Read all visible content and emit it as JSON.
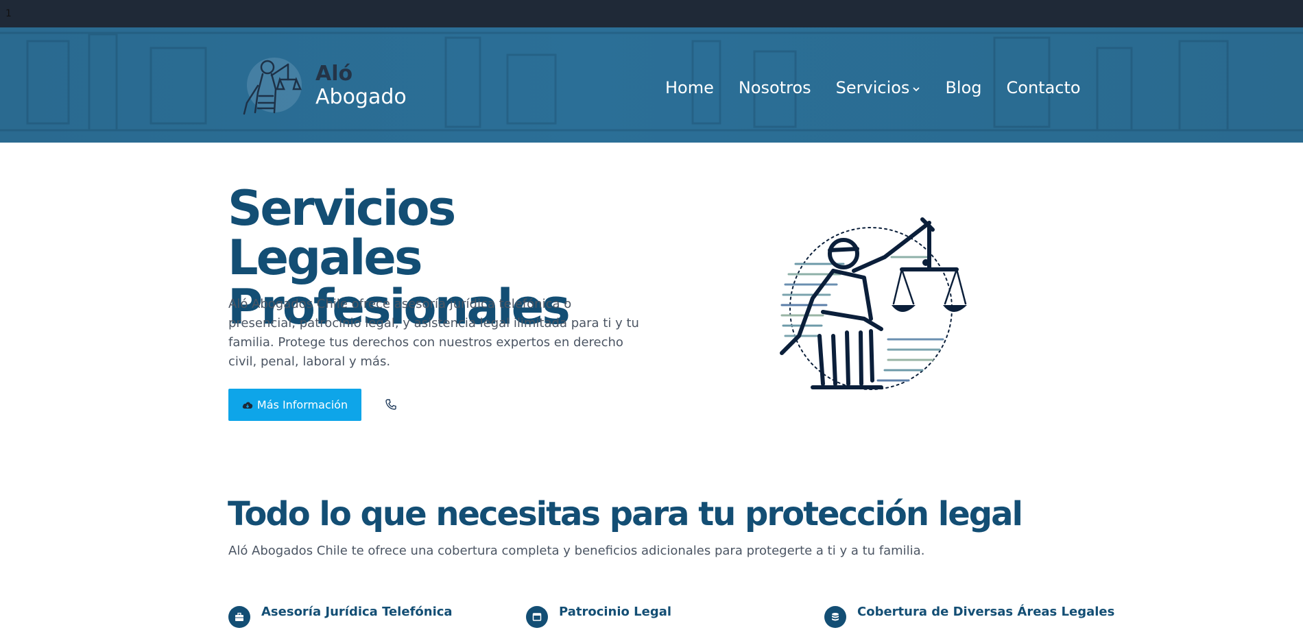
{
  "topbar": {
    "text": "1"
  },
  "brand": {
    "line1": "Aló",
    "line2": "Abogado",
    "logo_icon": "lady-justice-icon"
  },
  "nav": {
    "items": [
      {
        "label": "Home"
      },
      {
        "label": "Nosotros"
      },
      {
        "label": "Servicios",
        "has_dropdown": true
      },
      {
        "label": "Blog"
      },
      {
        "label": "Contacto"
      }
    ]
  },
  "hero": {
    "title": "Servicios Legales Profesionales",
    "text": "Aló Abogados Chile ofrece asesoría jurídica telefónica o presencial, patrocinio legal, y asistencia legal ilimitada para ti y tu familia. Protege tus derechos con nuestros expertos en derecho civil, penal, laboral y más.",
    "primary_button": "Más Información",
    "primary_button_icon": "cloud-download-icon",
    "phone_icon": "phone-icon",
    "illustration": "lady-justice-illustration"
  },
  "benefits": {
    "title": "Todo lo que necesitas para tu protección legal",
    "subtitle": "Aló Abogados Chile te ofrece una cobertura completa y beneficios adicionales para protegerte a ti y a tu familia.",
    "features": [
      {
        "label": "Asesoría Jurídica Telefónica",
        "icon": "briefcase-icon"
      },
      {
        "label": "Patrocinio Legal",
        "icon": "window-icon"
      },
      {
        "label": "Cobertura de Diversas Áreas Legales",
        "icon": "database-icon"
      }
    ]
  },
  "colors": {
    "primary_dark": "#134e74",
    "accent": "#0ea5e9",
    "header_bg": "#2a6a90",
    "topbar_bg": "#1f2937"
  }
}
